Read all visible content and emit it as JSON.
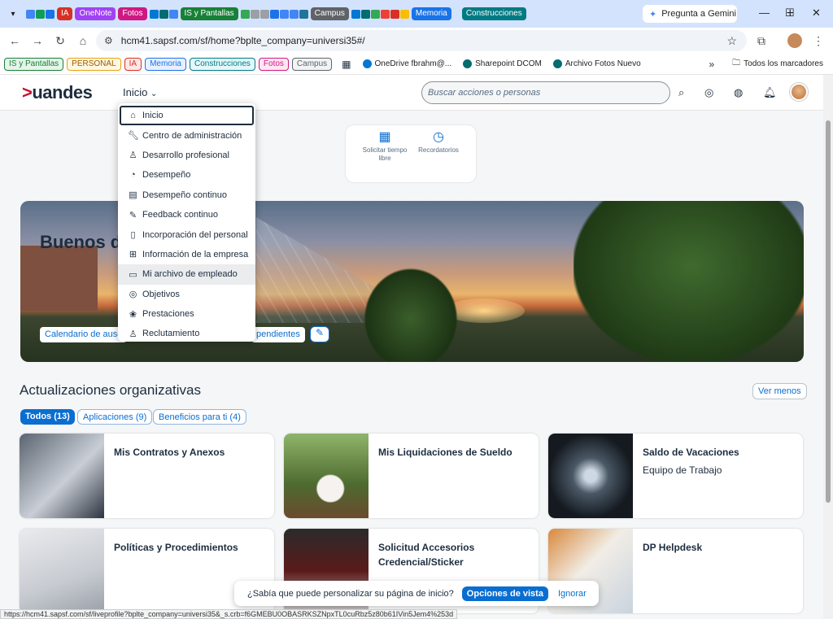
{
  "browser": {
    "tab_groups": [
      {
        "label": "IA",
        "color": "#d93025"
      },
      {
        "label": "OneNote",
        "color": "#a142f4"
      },
      {
        "label": "Fotos",
        "color": "#d01884"
      },
      {
        "label": "IS y Pantallas",
        "color": "#188038"
      },
      {
        "label": "Campus",
        "color": "#5f6368"
      },
      {
        "label": "Memoria",
        "color": "#1a73e8"
      },
      {
        "label": "Construcciones",
        "color": "#007b83"
      }
    ],
    "new_tab": "+",
    "gemini_label": "Pregunta a Gemini",
    "url": "hcm41.sapsf.com/sf/home?bplte_company=universi35#/",
    "bookmarks_groups": [
      {
        "label": "IS y Pantallas",
        "color": "#188038",
        "bg": "#e6f4ea"
      },
      {
        "label": "PERSONAL",
        "color": "#a05a00",
        "bg": "#fef7e0"
      },
      {
        "label": "IA",
        "color": "#d93025",
        "bg": "#fce8e6"
      },
      {
        "label": "Memoria",
        "color": "#1a73e8",
        "bg": "#e8f0fe"
      },
      {
        "label": "Construcciones",
        "color": "#007b83",
        "bg": "#e4f7fb"
      },
      {
        "label": "Fotos",
        "color": "#d01884",
        "bg": "#fde7f3"
      },
      {
        "label": "Campus",
        "color": "#5f6368",
        "bg": "#f1f3f4"
      }
    ],
    "bookmarks": [
      {
        "label": "OneDrive fbrahm@...",
        "color": "#0078d4"
      },
      {
        "label": "Sharepoint DCOM",
        "color": "#036c70"
      },
      {
        "label": "Archivo Fotos Nuevo",
        "color": "#036c70"
      }
    ],
    "more": "»",
    "all_bookmarks": "Todos los marcadores",
    "status_url": "https://hcm41.sapsf.com/sf/liveprofile?bplte_company=universi35&_s.crb=f6GMEBU0OBASRKSZNpxTL0cuRbz5z80b61IVin5Jem4%253d"
  },
  "shell": {
    "logo_mark": ">",
    "logo_text": "uandes",
    "home_label": "Inicio",
    "search_placeholder": "Buscar acciones o personas"
  },
  "quick_actions": [
    {
      "label": "Solicitar tiempo libre",
      "icon": "calendar-icon"
    },
    {
      "label": "Recordatorios",
      "icon": "reminder-icon"
    }
  ],
  "hero": {
    "greeting": "Buenos d",
    "links": [
      {
        "label": "Calendario de ause"
      },
      {
        "label": "pendientes"
      }
    ]
  },
  "menu": {
    "items": [
      {
        "label": "Inicio",
        "icon": "home-icon"
      },
      {
        "label": "Centro de administración",
        "icon": "wrench-icon"
      },
      {
        "label": "Desarrollo profesional",
        "icon": "person-icon"
      },
      {
        "label": "Desempeño",
        "icon": "gauge-icon"
      },
      {
        "label": "Desempeño continuo",
        "icon": "clipboard-icon"
      },
      {
        "label": "Feedback continuo",
        "icon": "feedback-icon"
      },
      {
        "label": "Incorporación del personal",
        "icon": "onboarding-icon"
      },
      {
        "label": "Información de la empresa",
        "icon": "org-chart-icon"
      },
      {
        "label": "Mi archivo de empleado",
        "icon": "id-card-icon"
      },
      {
        "label": "Objetivos",
        "icon": "target-icon"
      },
      {
        "label": "Prestaciones",
        "icon": "benefits-icon"
      },
      {
        "label": "Reclutamiento",
        "icon": "recruit-icon"
      }
    ]
  },
  "updates": {
    "title": "Actualizaciones organizativas",
    "toggle": "Ver menos",
    "filters": [
      {
        "label": "Todos (13)"
      },
      {
        "label": "Aplicaciones (9)"
      },
      {
        "label": "Beneficios para ti (4)"
      }
    ],
    "cards": [
      {
        "title": "Mis Contratos y Anexos",
        "subtitle": ""
      },
      {
        "title": "Mis Liquidaciones de Sueldo",
        "subtitle": ""
      },
      {
        "title": "Saldo de Vacaciones",
        "subtitle": "Equipo de Trabajo"
      },
      {
        "title": "Políticas y Procedimientos",
        "subtitle": ""
      },
      {
        "title": "Solicitud Accesorios Credencial/Sticker",
        "subtitle": ""
      },
      {
        "title": "DP Helpdesk",
        "subtitle": ""
      }
    ]
  },
  "toast": {
    "text": "¿Sabía que puede personalizar su página de inicio?",
    "primary": "Opciones de vista",
    "secondary": "Ignorar"
  }
}
